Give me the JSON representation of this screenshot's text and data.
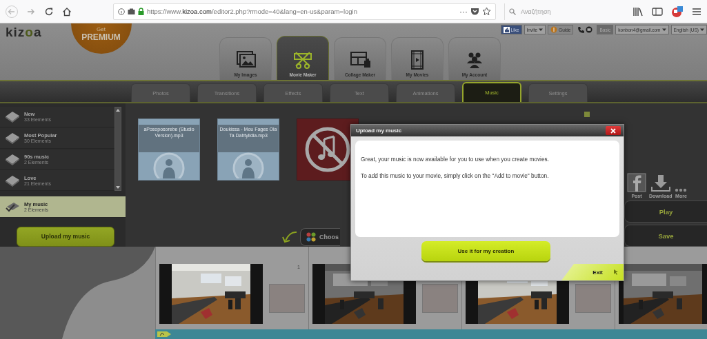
{
  "browser": {
    "url": "https://www.**kizoa.com**/editor2.php?rmode=40&lang=en-us&param=login",
    "page_actions": "···",
    "search_placeholder": "Αναζήτηση"
  },
  "header": {
    "logo": "kizoa",
    "premium": [
      "Get",
      "PREMIUM"
    ],
    "account_bar": [
      {
        "kind": "like",
        "label": "Like"
      },
      {
        "kind": "dropdown",
        "label": "Invite"
      },
      {
        "kind": "guide",
        "label": "Guide"
      },
      {
        "kind": "contact"
      },
      {
        "kind": "plan",
        "label": "Basic"
      },
      {
        "kind": "dropdown",
        "label": "konbon4@gmail.com"
      },
      {
        "kind": "dropdown",
        "label": "English (US)"
      }
    ],
    "main_tabs": [
      {
        "kind": "images",
        "label": "My Images",
        "selected": false
      },
      {
        "kind": "movie",
        "label": "Movie Maker",
        "selected": true
      },
      {
        "kind": "collage",
        "label": "Collage Maker",
        "selected": false
      },
      {
        "kind": "movies",
        "label": "My Movies",
        "selected": false
      },
      {
        "kind": "account",
        "label": "My Account",
        "selected": false
      }
    ]
  },
  "sub_tabs": [
    {
      "label": "Photos",
      "selected": false
    },
    {
      "label": "Transitions",
      "selected": false
    },
    {
      "label": "Effects",
      "selected": false
    },
    {
      "label": "Text",
      "selected": false
    },
    {
      "label": "Animations",
      "selected": false
    },
    {
      "label": "Music",
      "selected": true
    },
    {
      "label": "Settings",
      "selected": false
    }
  ],
  "categories": [
    {
      "name": "New",
      "count": "33 Elements",
      "selected": false
    },
    {
      "name": "Most Popular",
      "count": "30 Elements",
      "selected": false
    },
    {
      "name": "90s music",
      "count": "2 Elements",
      "selected": false
    },
    {
      "name": "Love",
      "count": "21 Elements",
      "selected": false
    }
  ],
  "my_music": {
    "name": "My music",
    "count": "2 Elements",
    "selected": true
  },
  "upload_button": "Upload my music",
  "tracks": [
    {
      "kind": "file",
      "title": "aPosoposorebe (Studio Version).mp3"
    },
    {
      "kind": "file",
      "title": "Doukissa - Mou Fages Ola Ta Dahtylidia.mp3"
    },
    {
      "kind": "no_music"
    }
  ],
  "choose_button": "Choos",
  "share": [
    {
      "kind": "facebook",
      "label": "Post"
    },
    {
      "kind": "download",
      "label": "Download"
    },
    {
      "kind": "more",
      "label": "More"
    }
  ],
  "actions": [
    "Play",
    "Save"
  ],
  "dialog": {
    "title": "Upload my music",
    "paragraphs": [
      "Great, your music is now available for you to use when you create movies.",
      "To add this music to your movie, simply click on the \"Add to movie\" button."
    ],
    "button": "Use it for my creation",
    "exit": "Exit"
  },
  "timeline": {
    "clips": [
      {
        "kind": "picture",
        "number": "1"
      },
      {
        "kind": "picture"
      },
      {
        "kind": "picture"
      },
      {
        "kind": "picture"
      }
    ]
  }
}
